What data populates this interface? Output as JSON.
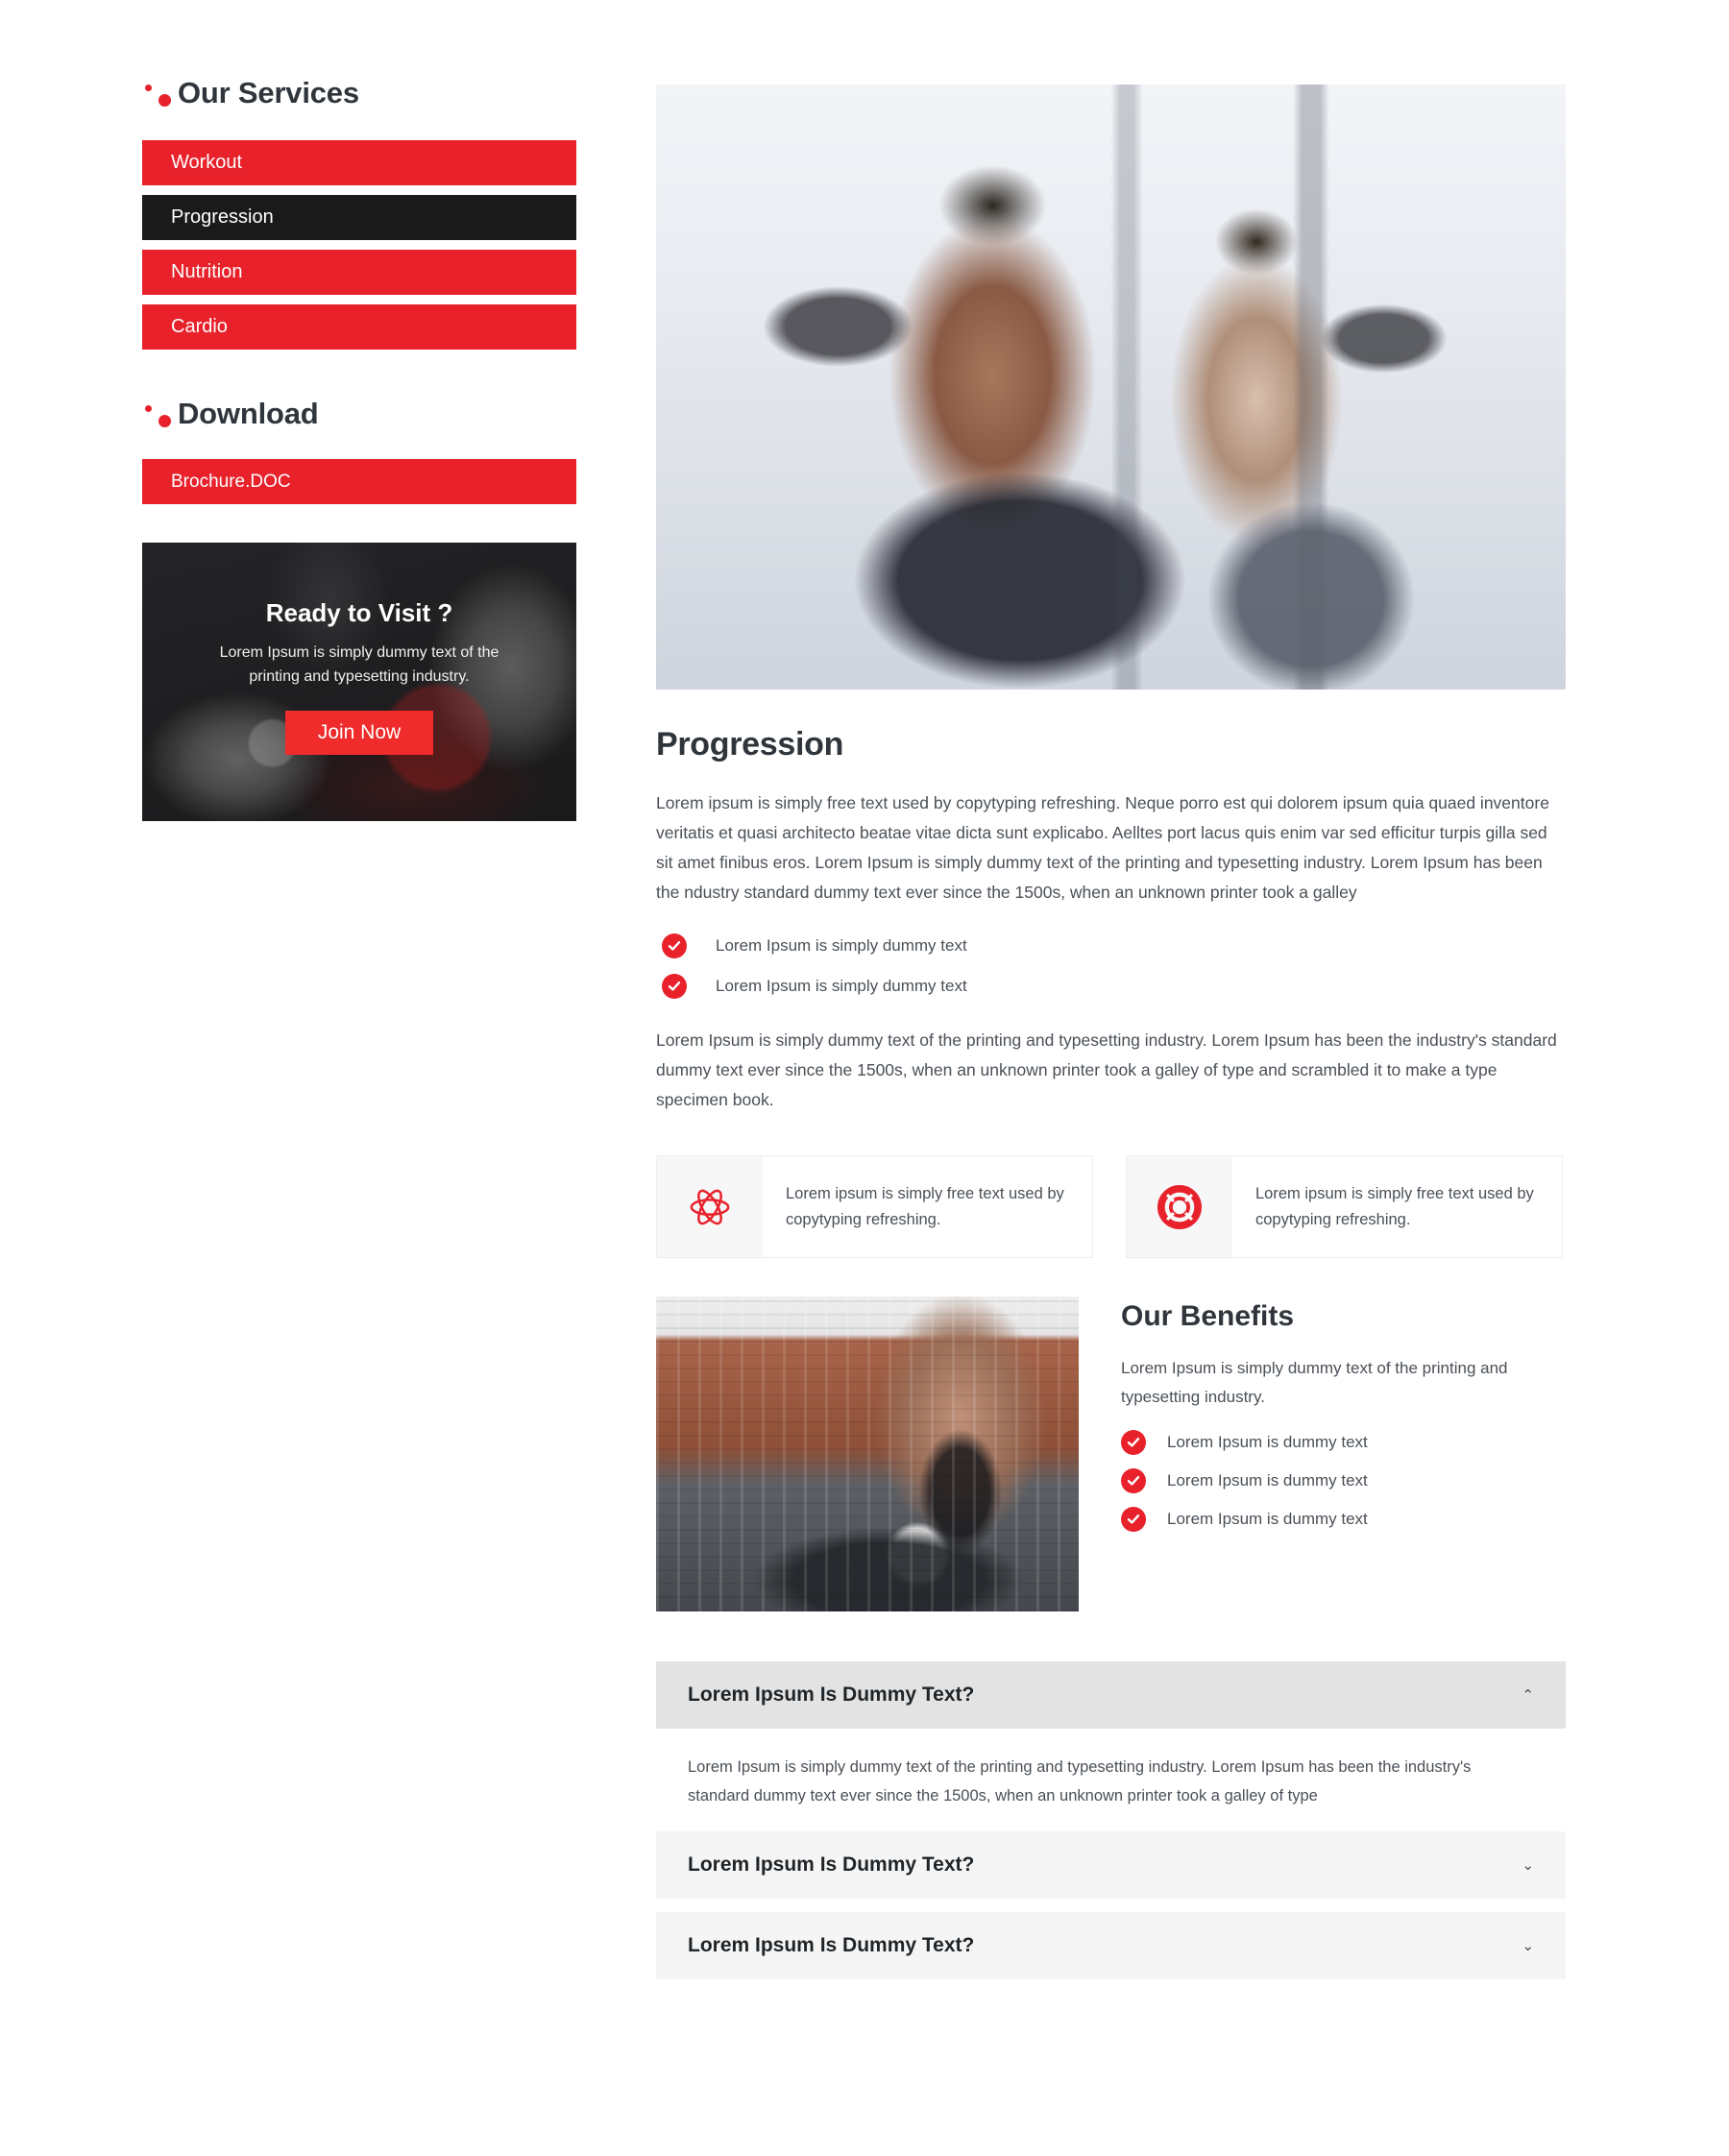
{
  "sidebar": {
    "services": {
      "title": "Our Services",
      "items": [
        {
          "label": "Workout",
          "active": false
        },
        {
          "label": "Progression",
          "active": true
        },
        {
          "label": "Nutrition",
          "active": false
        },
        {
          "label": "Cardio",
          "active": false
        }
      ]
    },
    "download": {
      "title": "Download",
      "items": [
        {
          "label": "Brochure.DOC"
        }
      ]
    },
    "promo": {
      "heading": "Ready to Visit ?",
      "text": "Lorem Ipsum is simply dummy text of the printing and typesetting industry.",
      "button_label": "Join Now"
    }
  },
  "main": {
    "hero_image_alt": "woman-lifting-dumbbells-with-trainer",
    "heading": "Progression",
    "paragraph_1": "Lorem ipsum is simply free text used by copytyping refreshing. Neque porro est qui dolorem ipsum quia quaed inventore veritatis et quasi architecto beatae vitae dicta sunt explicabo. Aelltes port lacus quis enim var sed efficitur turpis gilla sed sit amet finibus eros. Lorem Ipsum is simply dummy text of the printing and typesetting industry. Lorem Ipsum has been the ndustry standard dummy text ever since the 1500s, when an unknown printer took a galley",
    "checklist": [
      {
        "label": "Lorem Ipsum is simply dummy text"
      },
      {
        "label": "Lorem Ipsum is simply dummy text"
      }
    ],
    "paragraph_2": "Lorem Ipsum is simply dummy text of the printing and typesetting industry. Lorem Ipsum has been the industry's standard dummy text ever since the 1500s, when an unknown printer took a galley of type and scrambled it to make a type specimen book.",
    "features": [
      {
        "icon": "atom-icon",
        "text": "Lorem ipsum is simply free text used by copytyping refreshing."
      },
      {
        "icon": "lifebuoy-icon",
        "text": "Lorem ipsum is simply free text used by copytyping refreshing."
      }
    ],
    "benefits": {
      "image_alt": "woman-stepping-on-tire-in-gym",
      "heading": "Our Benefits",
      "text": "Lorem Ipsum is simply dummy text of the printing and typesetting industry.",
      "items": [
        {
          "label": "Lorem Ipsum is dummy text"
        },
        {
          "label": "Lorem Ipsum is dummy text"
        },
        {
          "label": "Lorem Ipsum is dummy text"
        }
      ]
    },
    "faq": [
      {
        "question": "Lorem Ipsum Is Dummy Text?",
        "chevron": "⌃",
        "open": true,
        "answer": "Lorem Ipsum is simply dummy text of the printing and typesetting industry. Lorem Ipsum has been the industry's standard dummy text ever since the 1500s, when an unknown printer took a galley of type"
      },
      {
        "question": "Lorem Ipsum Is Dummy Text?",
        "chevron": "⌄",
        "open": false,
        "answer": ""
      },
      {
        "question": "Lorem Ipsum Is Dummy Text?",
        "chevron": "⌄",
        "open": false,
        "answer": ""
      }
    ]
  },
  "colors": {
    "accent_red": "#e8212b",
    "active_dark": "#1a1a1a",
    "heading": "#2f353b",
    "body_text": "#4a5057",
    "faq_bg": "#f5f5f5",
    "faq_open_bg": "#e3e3e3",
    "feature_icon_bg": "#f7f7f8"
  }
}
